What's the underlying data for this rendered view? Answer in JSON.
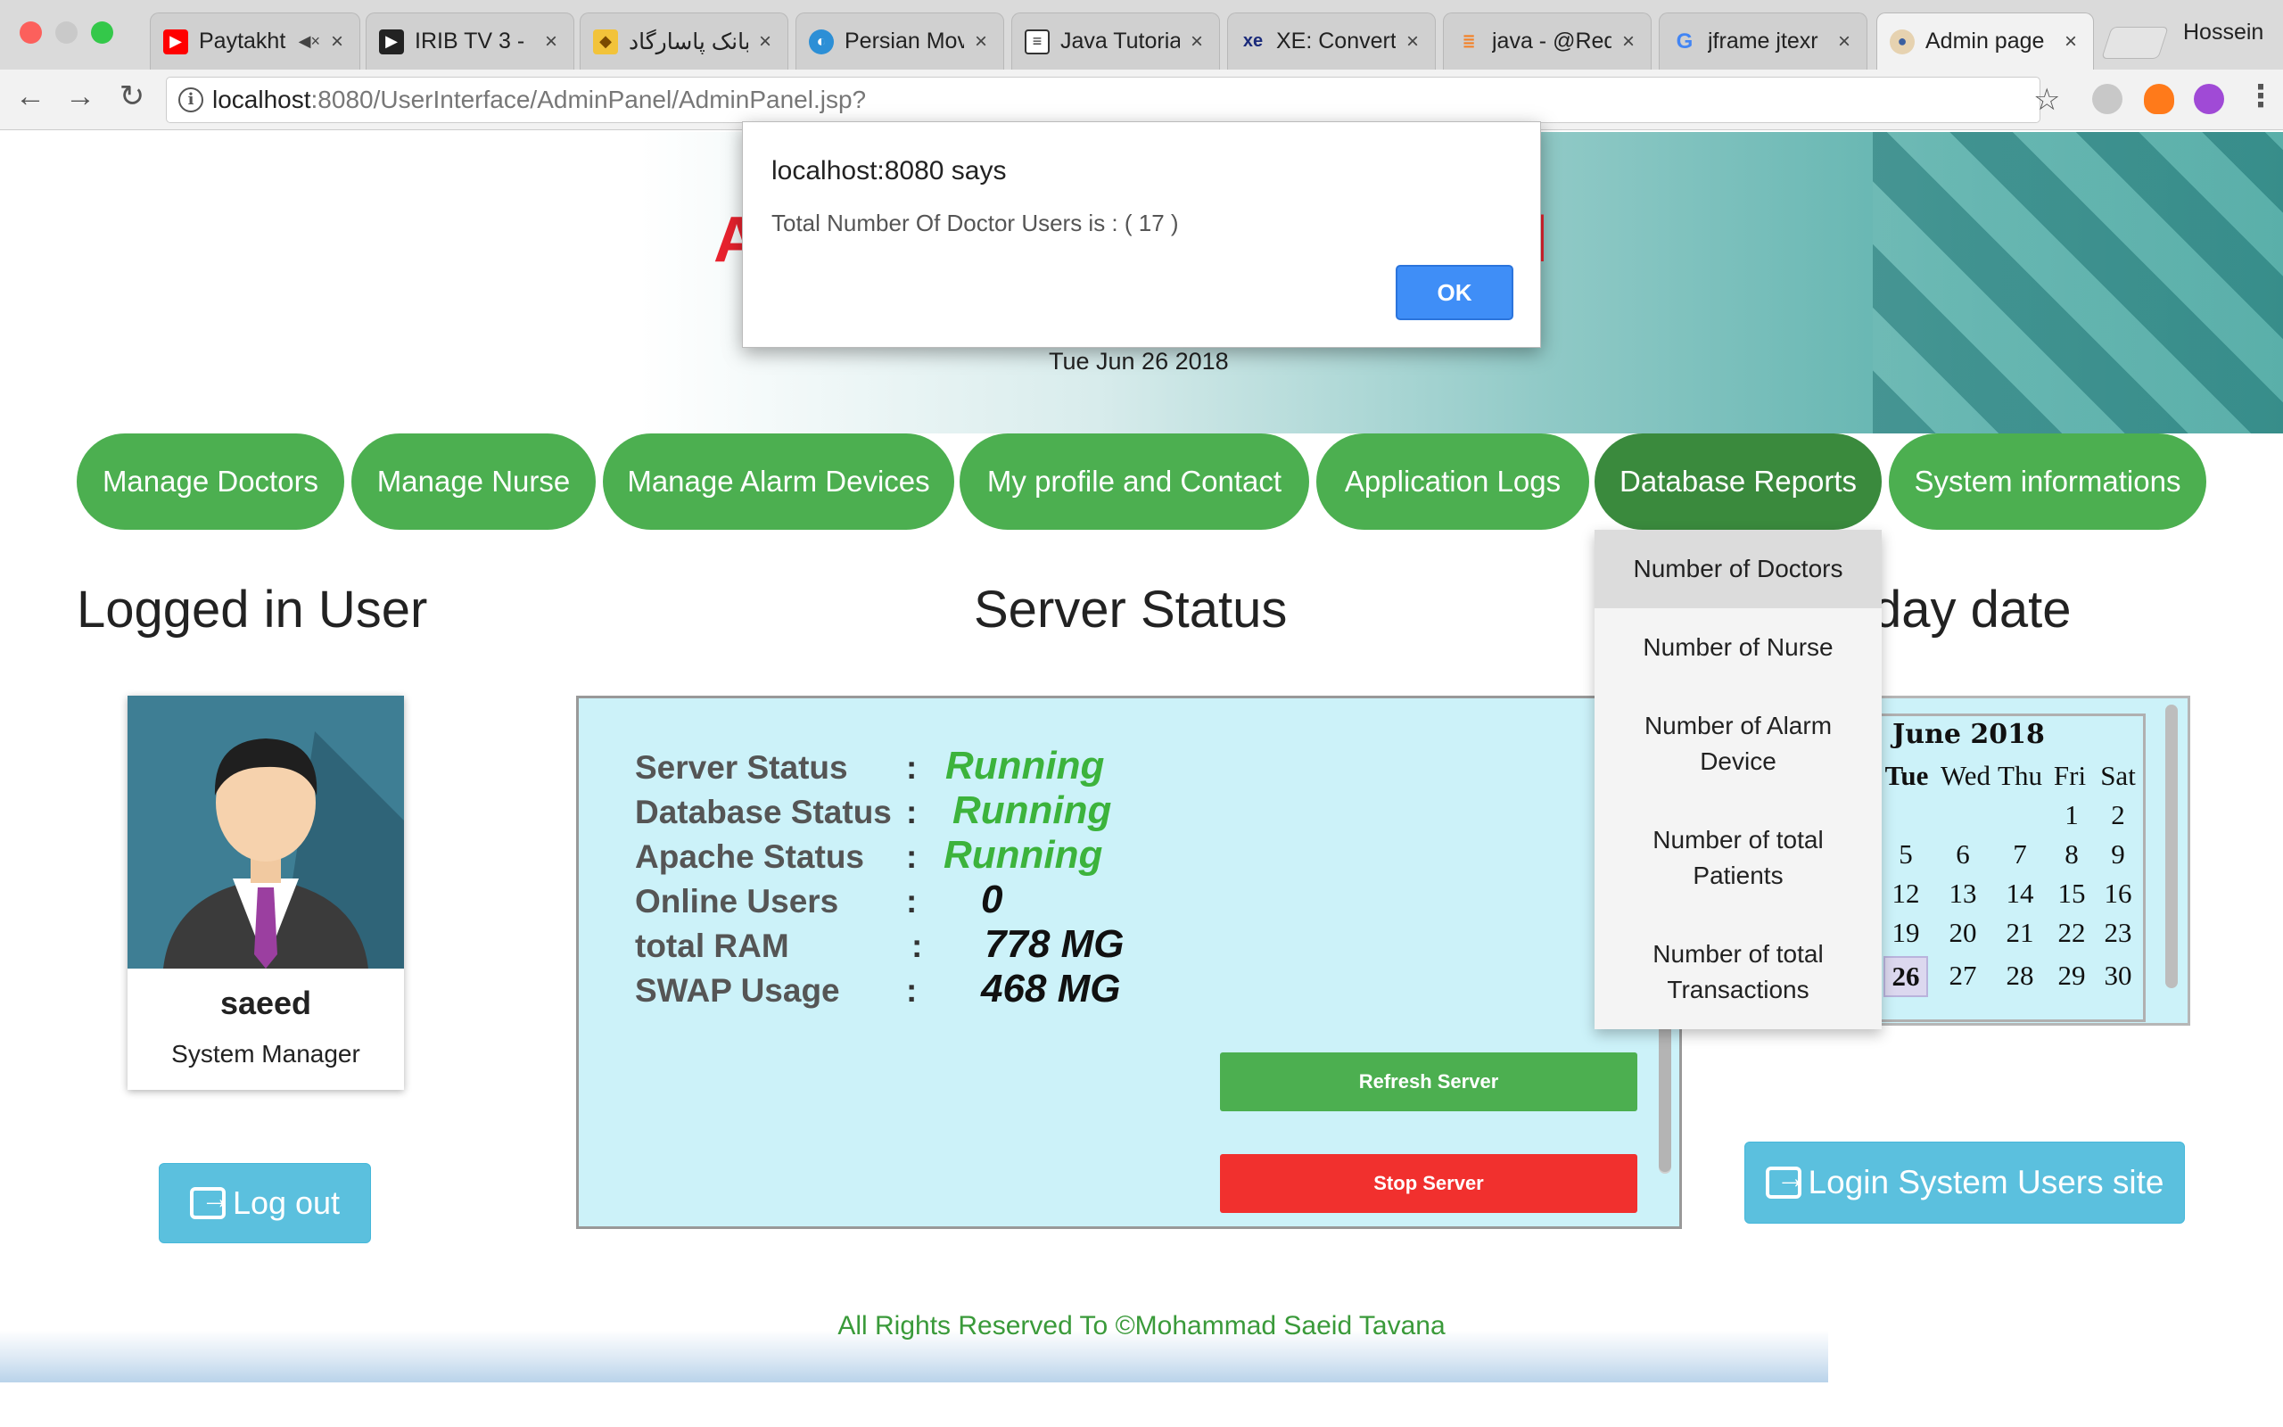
{
  "browser": {
    "tabs": [
      {
        "title": "Paytakht",
        "icon": "youtube-icon",
        "muted": true
      },
      {
        "title": "IRIB TV 3 - ",
        "icon": "play-icon"
      },
      {
        "title": "بانک پاسارگاد ::",
        "icon": "bank-icon"
      },
      {
        "title": "Persian Mov",
        "icon": "globe-icon"
      },
      {
        "title": "Java Tutoria",
        "icon": "book-icon"
      },
      {
        "title": "XE: Convert",
        "icon": "xe-icon"
      },
      {
        "title": "java - @Req",
        "icon": "stackoverflow-icon"
      },
      {
        "title": "jframe jtexr",
        "icon": "google-icon"
      },
      {
        "title": "Admin page",
        "icon": "admin-icon",
        "active": true
      }
    ],
    "profile_name": "Hossein",
    "url_host": "localhost",
    "url_path": ":8080/UserInterface/AdminPanel/AdminPanel.jsp?"
  },
  "header": {
    "title_start": "A",
    "title_end": "l",
    "date": "Tue Jun 26 2018"
  },
  "nav": {
    "items": [
      "Manage Doctors",
      "Manage Nurse",
      "Manage Alarm Devices",
      "My profile and Contact",
      "Application Logs",
      "Database Reports",
      "System informations"
    ],
    "dropdown": [
      "Number of Doctors",
      "Number of Nurse",
      "Number of Alarm Device",
      "Number of total Patients",
      "Number of total Transactions"
    ]
  },
  "user": {
    "section_title": "Logged in User",
    "name": "saeed",
    "role": "System Manager",
    "logout_label": "Log out"
  },
  "server": {
    "section_title": "Server Status",
    "rows": [
      {
        "label": "Server Status",
        "value": "Running"
      },
      {
        "label": "Database Status",
        "value": "Running"
      },
      {
        "label": "Apache Status",
        "value": "Running"
      },
      {
        "label": "Online Users",
        "value": "0"
      },
      {
        "label": "total RAM",
        "value": "778 MG"
      },
      {
        "label": "SWAP Usage",
        "value": "468 MG"
      }
    ],
    "colon": ":",
    "refresh_label": "Refresh Server",
    "stop_label": "Stop Server",
    "ok_color": "#3cb33c"
  },
  "calendar": {
    "section_title_visible": "day date",
    "month": "June 2018",
    "weekdays": [
      "Tue",
      "Wed",
      "Thu",
      "Fri",
      "Sat"
    ],
    "days": [
      "1",
      "2",
      "5",
      "6",
      "7",
      "8",
      "9",
      "12",
      "13",
      "14",
      "15",
      "16",
      "19",
      "20",
      "21",
      "22",
      "23",
      "26",
      "27",
      "28",
      "29",
      "30"
    ],
    "today": "26",
    "login_sys_label": "Login System Users site"
  },
  "footer": {
    "text": "All Rights Reserved To ©Mohammad Saeid Tavana"
  },
  "alert": {
    "title": "localhost:8080 says",
    "message": "Total Number Of Doctor Users is : ( 17 )",
    "ok_label": "OK"
  },
  "colors": {
    "nav_green": "#4caf50",
    "nav_active": "#3a8a3d",
    "title_red": "#e8222e",
    "info_blue": "#5bc0de",
    "danger_red": "#f1302e",
    "dialog_blue": "#3f8ef7"
  }
}
